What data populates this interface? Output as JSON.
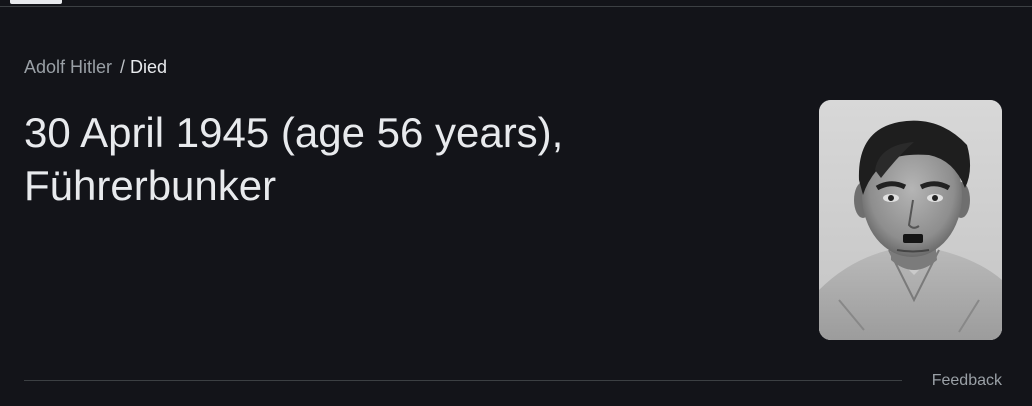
{
  "breadcrumb": {
    "entity": "Adolf Hitler",
    "separator": "/",
    "attribute": "Died"
  },
  "answer": {
    "line1": "30 April 1945 (age 56 years),",
    "line2": "Führerbunker"
  },
  "image": {
    "icon": "portrait-photo",
    "style": "black-and-white"
  },
  "footer": {
    "feedback_label": "Feedback"
  },
  "colors": {
    "background": "#131419",
    "primary_text": "#e8eaed",
    "secondary_text": "#9aa0a6",
    "divider": "#3c4043"
  }
}
